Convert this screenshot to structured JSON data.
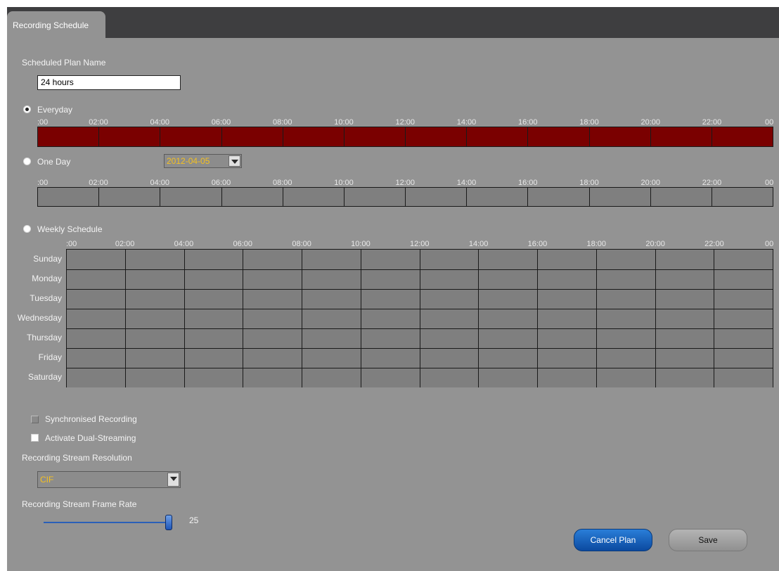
{
  "tab": {
    "label": "Recording Schedule"
  },
  "plan": {
    "label": "Scheduled Plan Name",
    "value": "24 hours"
  },
  "time_labels": [
    ":00",
    "02:00",
    "04:00",
    "06:00",
    "08:00",
    "10:00",
    "12:00",
    "14:00",
    "16:00",
    "18:00",
    "20:00",
    "22:00",
    "00"
  ],
  "modes": {
    "everyday": {
      "label": "Everyday",
      "selected": true
    },
    "one_day": {
      "label": "One Day",
      "selected": false,
      "date": "2012-04-05"
    },
    "weekly": {
      "label": "Weekly Schedule",
      "selected": false
    }
  },
  "days": [
    "Sunday",
    "Monday",
    "Tuesday",
    "Wednesday",
    "Thursday",
    "Friday",
    "Saturday"
  ],
  "options": {
    "sync_label": "Synchronised Recording",
    "dual_label": "Activate Dual-Streaming"
  },
  "resolution": {
    "label": "Recording Stream Resolution",
    "value": "CIF"
  },
  "framerate": {
    "label": "Recording Stream Frame Rate",
    "value": "25",
    "fraction": 1.0
  },
  "buttons": {
    "cancel": "Cancel Plan",
    "save": "Save"
  },
  "colors": {
    "scheduled": "#7a0000",
    "unscheduled": "#7f7f7f",
    "panel": "#939393",
    "header": "#3e3e40",
    "accent": "#0c4aa0"
  }
}
